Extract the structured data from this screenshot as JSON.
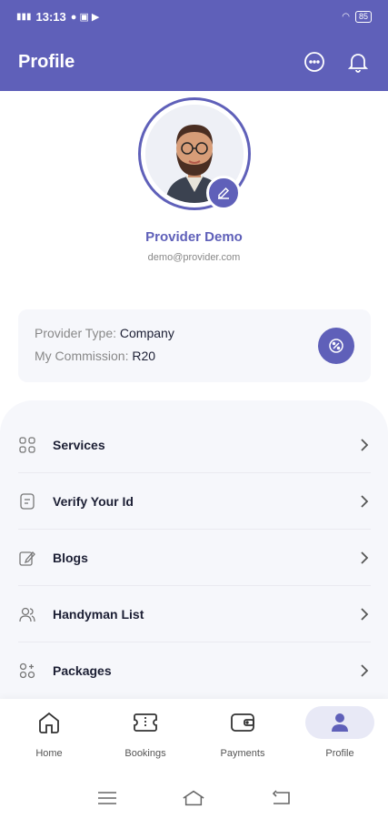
{
  "status_bar": {
    "time": "13:13",
    "battery": "85"
  },
  "header": {
    "title": "Profile",
    "chat_icon": "chat-bubble-icon",
    "bell_icon": "bell-icon"
  },
  "profile": {
    "name": "Provider Demo",
    "email": "demo@provider.com"
  },
  "info_card": {
    "type_label": "Provider Type:",
    "type_value": "Company",
    "commission_label": "My Commission:",
    "commission_value": "R20"
  },
  "menu": {
    "items": [
      {
        "label": "Services",
        "icon": "grid-icon"
      },
      {
        "label": "Verify Your Id",
        "icon": "document-icon"
      },
      {
        "label": "Blogs",
        "icon": "edit-note-icon"
      },
      {
        "label": "Handyman List",
        "icon": "users-icon"
      },
      {
        "label": "Packages",
        "icon": "package-icon"
      }
    ]
  },
  "bottom_nav": {
    "items": [
      {
        "label": "Home",
        "icon": "home-icon"
      },
      {
        "label": "Bookings",
        "icon": "ticket-icon"
      },
      {
        "label": "Payments",
        "icon": "wallet-icon"
      },
      {
        "label": "Profile",
        "icon": "person-icon"
      }
    ],
    "active": "Profile"
  },
  "colors": {
    "primary": "#5f60b9",
    "surface": "#f6f7fb",
    "text": "#1c1f34",
    "muted": "#888888"
  }
}
